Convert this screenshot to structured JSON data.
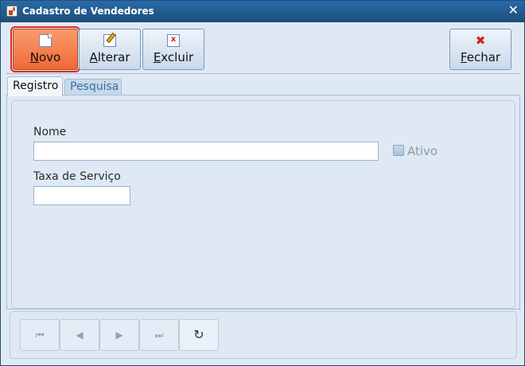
{
  "window": {
    "title": "Cadastro de Vendedores"
  },
  "toolbar": {
    "novo": {
      "first": "N",
      "rest": "ovo"
    },
    "alterar": {
      "first": "A",
      "rest": "lterar"
    },
    "excluir": {
      "first": "E",
      "rest": "xcluir"
    },
    "fechar": {
      "first": "F",
      "rest": "echar"
    }
  },
  "tabs": [
    {
      "label": "Registro",
      "selected": true
    },
    {
      "label": "Pesquisa",
      "selected": false
    }
  ],
  "form": {
    "nome_label": "Nome",
    "nome_value": "",
    "ativo_label": "Ativo",
    "ativo_checked": false,
    "taxa_label": "Taxa de Serviço",
    "taxa_value": ""
  },
  "navigator": {
    "first": "⏮",
    "prev": "◀",
    "next": "▶",
    "last": "⏭",
    "refresh": "↻"
  },
  "colors": {
    "active_button": "#ee6a36",
    "titlebar": "#1b4d7a",
    "background": "#dfe9f3"
  }
}
